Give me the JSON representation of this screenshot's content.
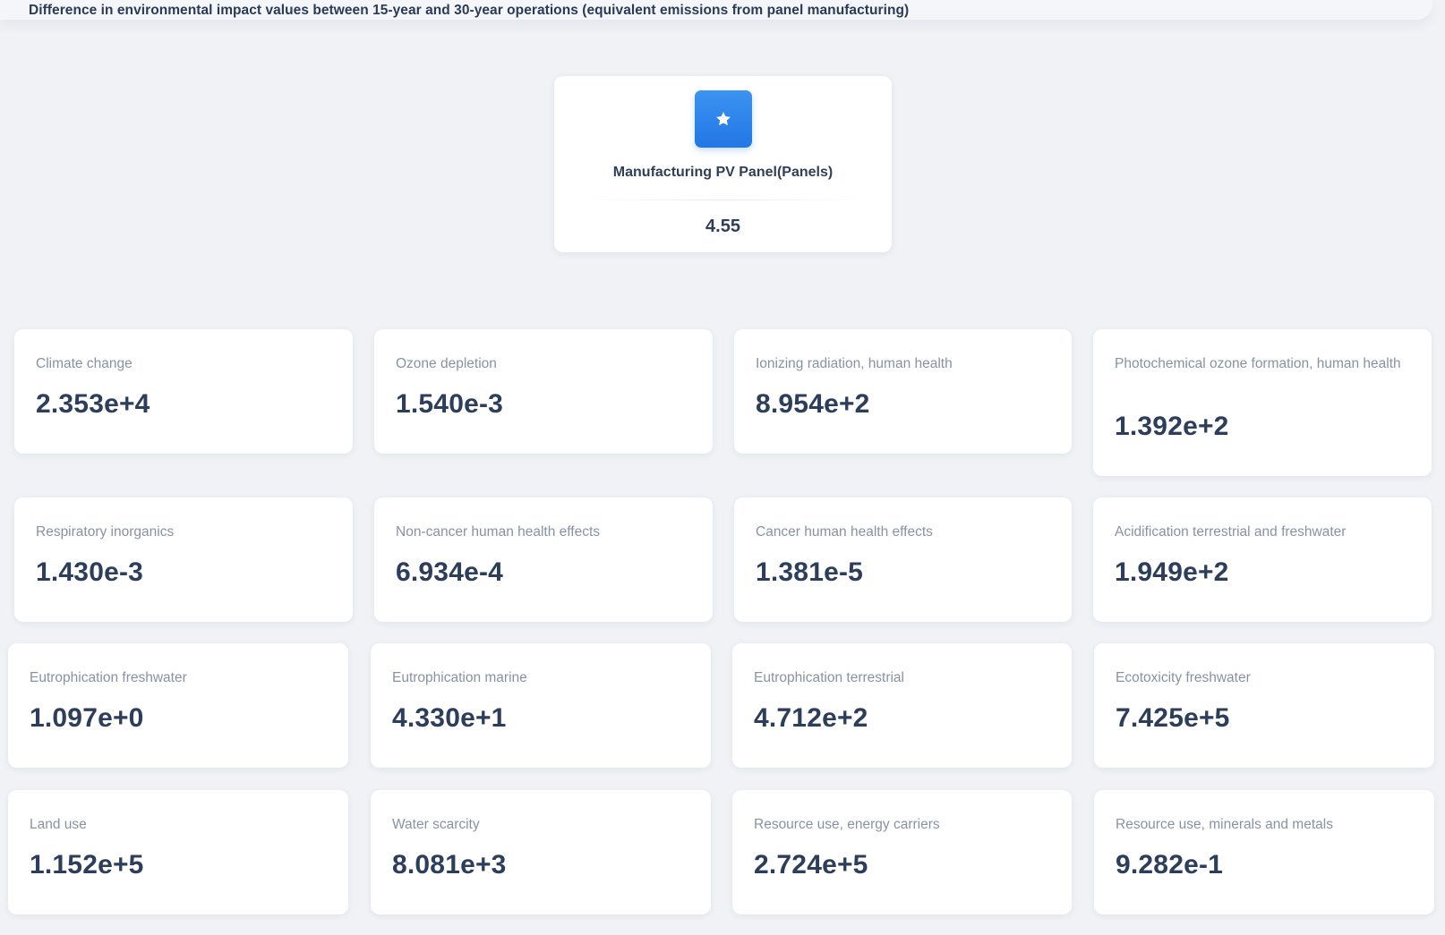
{
  "header": {
    "title": "Difference in environmental impact values between 15-year and 30-year operations (equivalent emissions from panel manufacturing)"
  },
  "summary": {
    "icon": "star-icon",
    "accent_color": "#2f86ec",
    "label": "Manufacturing PV Panel(Panels)",
    "value": "4.55"
  },
  "metrics": [
    {
      "label": "Climate change",
      "value": "2.353e+4"
    },
    {
      "label": "Ozone depletion",
      "value": "1.540e-3"
    },
    {
      "label": "Ionizing radiation, human health",
      "value": "8.954e+2"
    },
    {
      "label": "Photochemical ozone formation, human health",
      "value": "1.392e+2"
    },
    {
      "label": "Respiratory inorganics",
      "value": "1.430e-3"
    },
    {
      "label": "Non-cancer human health effects",
      "value": "6.934e-4"
    },
    {
      "label": "Cancer human health effects",
      "value": "1.381e-5"
    },
    {
      "label": "Acidification terrestrial and freshwater",
      "value": "1.949e+2"
    },
    {
      "label": "Eutrophication freshwater",
      "value": "1.097e+0"
    },
    {
      "label": "Eutrophication marine",
      "value": "4.330e+1"
    },
    {
      "label": "Eutrophication terrestrial",
      "value": "4.712e+2"
    },
    {
      "label": "Ecotoxicity freshwater",
      "value": "7.425e+5"
    },
    {
      "label": "Land use",
      "value": "1.152e+5"
    },
    {
      "label": "Water scarcity",
      "value": "8.081e+3"
    },
    {
      "label": "Resource use, energy carriers",
      "value": "2.724e+5"
    },
    {
      "label": "Resource use, minerals and metals",
      "value": "9.282e-1"
    }
  ]
}
